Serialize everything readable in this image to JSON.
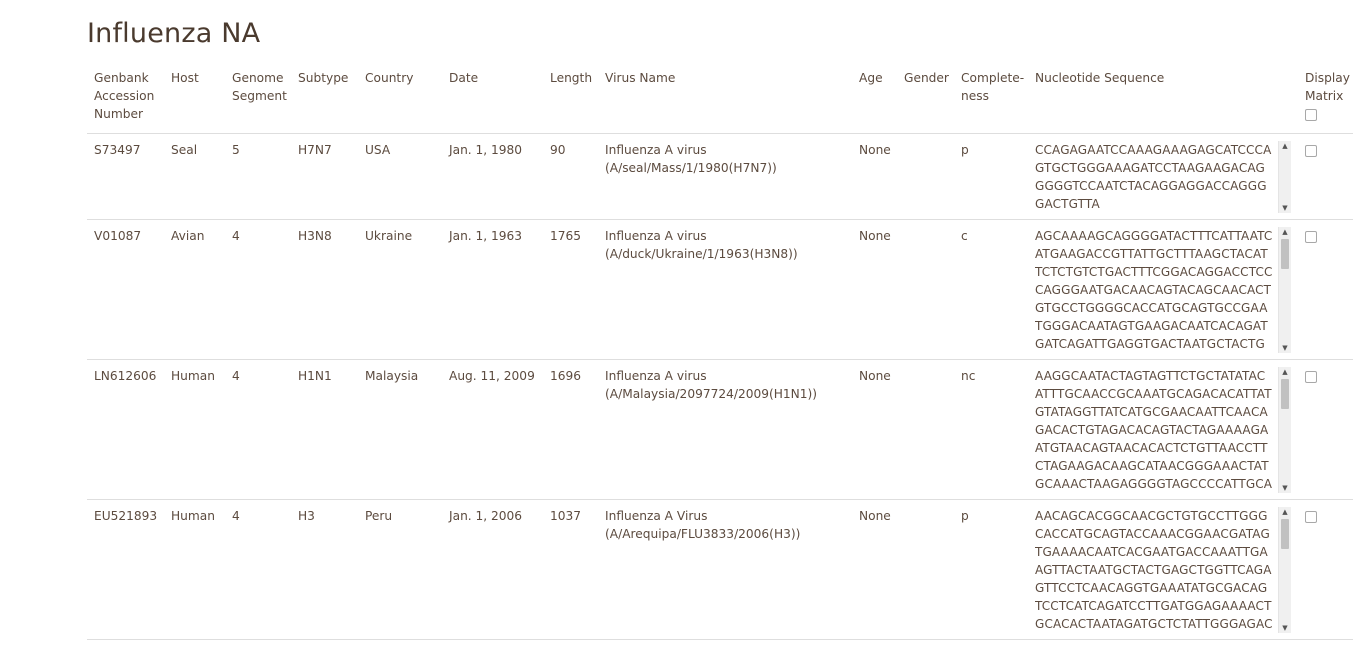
{
  "page": {
    "title": "Influenza NA"
  },
  "columns": {
    "accession": "Genbank Accession Number",
    "host": "Host",
    "segment": "Genome Segment",
    "subtype": "Subtype",
    "country": "Country",
    "date": "Date",
    "length": "Length",
    "virus_name": "Virus Name",
    "age": "Age",
    "gender": "Gender",
    "completeness": "Complete-ness",
    "sequence": "Nucleotide Sequence",
    "display_matrix": "Display Matrix"
  },
  "rows": [
    {
      "accession": "S73497",
      "host": "Seal",
      "segment": "5",
      "subtype": "H7N7",
      "country": "USA",
      "date": "Jan. 1, 1980",
      "length": "90",
      "virus_name": "Influenza A virus (A/seal/Mass/1/1980(H7N7))",
      "age": "None",
      "gender": "",
      "completeness": "p",
      "sequence": "CCAGAGAATCCAAAGAAAGAGCATCCCAGTGCTGGGAAAGATCCTAAGAAGACAGGGGGTCCAATCTACAGGAGGACCAGGGGACTGTTA"
    },
    {
      "accession": "V01087",
      "host": "Avian",
      "segment": "4",
      "subtype": "H3N8",
      "country": "Ukraine",
      "date": "Jan. 1, 1963",
      "length": "1765",
      "virus_name": "Influenza A virus (A/duck/Ukraine/1/1963(H3N8))",
      "age": "None",
      "gender": "",
      "completeness": "c",
      "sequence": "AGCAAAAGCAGGGGATACTTTCATTAATCATGAAGACCGTTATTGCTTTAAGCTACATTCTCTGTCTGACTTTCGGACAGGACCTCCCAGGGAATGACAACAGTACAGCAACACTGTGCCTGGGGCACCATGCAGTGCCGAATGGGACAATAGTGAAGACAATCACAGATGATCAGATTGAGGTGACTAATGCTACTGAGCTAGTTCAAACCTCCTCAACAGGCAAAATATGCAAC"
    },
    {
      "accession": "LN612606",
      "host": "Human",
      "segment": "4",
      "subtype": "H1N1",
      "country": "Malaysia",
      "date": "Aug. 11, 2009",
      "length": "1696",
      "virus_name": "Influenza A virus (A/Malaysia/2097724/2009(H1N1))",
      "age": "None",
      "gender": "",
      "completeness": "nc",
      "sequence": "AAGGCAATACTAGTAGTTCTGCTATATACATTTGCAACCGCAAATGCAGACACATTATGTATAGGTTATCATGCGAACAATTCAACAGACACTGTAGACACAGTACTAGAAAAGAATGTAACAGTAACACACTCTGTTAACCTTCTAGAAGACAAGCATAACGGGAAACTATGCAAACTAAGAGGGGTAGCCCCATTGCATTTGGGTAAATGTAACATTGCTGGCTGGATCCTGGGAA"
    },
    {
      "accession": "EU521893",
      "host": "Human",
      "segment": "4",
      "subtype": "H3",
      "country": "Peru",
      "date": "Jan. 1, 2006",
      "length": "1037",
      "virus_name": "Influenza A Virus (A/Arequipa/FLU3833/2006(H3))",
      "age": "None",
      "gender": "",
      "completeness": "p",
      "sequence": "AACAGCACGGCAACGCTGTGCCTTGGGCACCATGCAGTACCAAACGGAACGATAGTGAAAACAATCACGAATGACCAAATTGAAGTTACTAATGCTACTGAGCTGGTTCAGAGTTCCTCAACAGGTGAAATATGCGACAGTCCTCATCAGATCCTTGATGGAGAAAACTGCACACTAATAGATGCTCTATTGGGAGACCCTCAGTGTGATGGCTTCCAAAATAAGAAATGGGACCTTT"
    }
  ]
}
